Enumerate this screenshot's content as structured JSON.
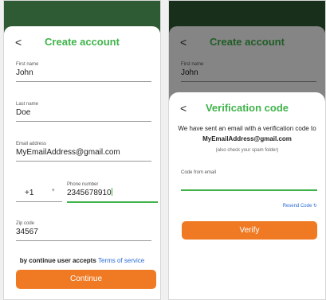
{
  "left_screen": {
    "back_glyph": "<",
    "title": "Create account",
    "fields": [
      {
        "label": "First name",
        "value": "John"
      },
      {
        "label": "Last name",
        "value": "Doe"
      },
      {
        "label": "Email address",
        "value": "MyEmailAddress@gmail.com"
      }
    ],
    "country_code": "+1",
    "phone_label": "Phone number",
    "phone_value": "2345678910",
    "zip": {
      "label": "Zip code",
      "value": "34567"
    },
    "terms_text": "by continue user accepts",
    "terms_link": "Terms of service",
    "continue_label": "Continue"
  },
  "right_screen": {
    "bg_back_glyph": "<",
    "bg_title": "Create account",
    "bg_field": {
      "label": "First name",
      "value": "John"
    },
    "modal": {
      "back_glyph": "<",
      "title": "Verification code",
      "message_prefix": "We have sent an email with a verification code to",
      "email": "MyEmailAddress@gmail.com",
      "note": "(also check your spam folder)",
      "code_label": "Code from email",
      "resend_label": "Resend Code",
      "resend_icon": "↻",
      "verify_label": "Verify"
    }
  },
  "colors": {
    "green": "#3fb34a",
    "orange": "#f07a24",
    "link": "#2a6bd6",
    "top_bar": "#2e5a34"
  }
}
